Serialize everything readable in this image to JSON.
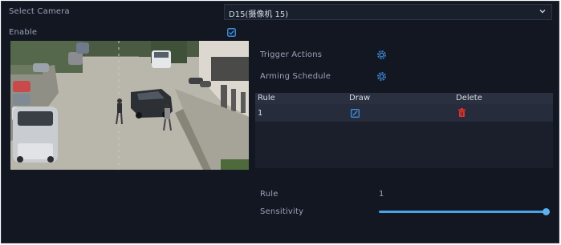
{
  "labels": {
    "select_camera": "Select Camera",
    "enable": "Enable",
    "trigger_actions": "Trigger Actions",
    "arming_schedule": "Arming Schedule",
    "rule": "Rule",
    "sensitivity": "Sensitivity"
  },
  "camera": {
    "selected": "D15(摄像机 15)"
  },
  "enable_checked": true,
  "table": {
    "headers": [
      "Rule",
      "Draw",
      "Delete"
    ],
    "rows": [
      {
        "rule": "1"
      }
    ]
  },
  "rule_value": "1",
  "sensitivity": {
    "value_fraction": 1.0
  },
  "colors": {
    "accent": "#4aa3e8",
    "delete": "#e0322b",
    "panel": "#131722"
  }
}
